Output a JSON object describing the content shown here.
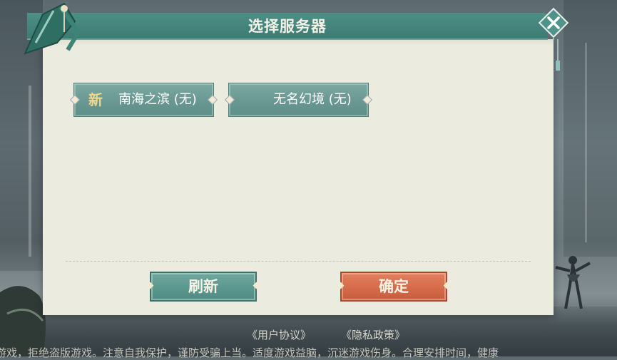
{
  "dialog": {
    "title": "选择服务器"
  },
  "servers": [
    {
      "badge": "新",
      "label": "南海之滨 (无)"
    },
    {
      "badge": "",
      "label": "无名幻境 (无)"
    }
  ],
  "actions": {
    "refresh_label": "刷新",
    "confirm_label": "确定"
  },
  "footer": {
    "user_agreement": "《用户协议》",
    "privacy_policy": "《隐私政策》",
    "notice": "游戏，拒绝盗版游戏。注意自我保护，谨防受骗上当。适度游戏益脑，沉迷游戏伤身。合理安排时间，健康"
  },
  "colors": {
    "title_bar": "#3f7e76",
    "panel_bg": "#ecebe0",
    "server_button": "#6a9892",
    "refresh_button": "#5a978d",
    "confirm_button": "#d46a48",
    "new_badge": "#f4d789"
  }
}
